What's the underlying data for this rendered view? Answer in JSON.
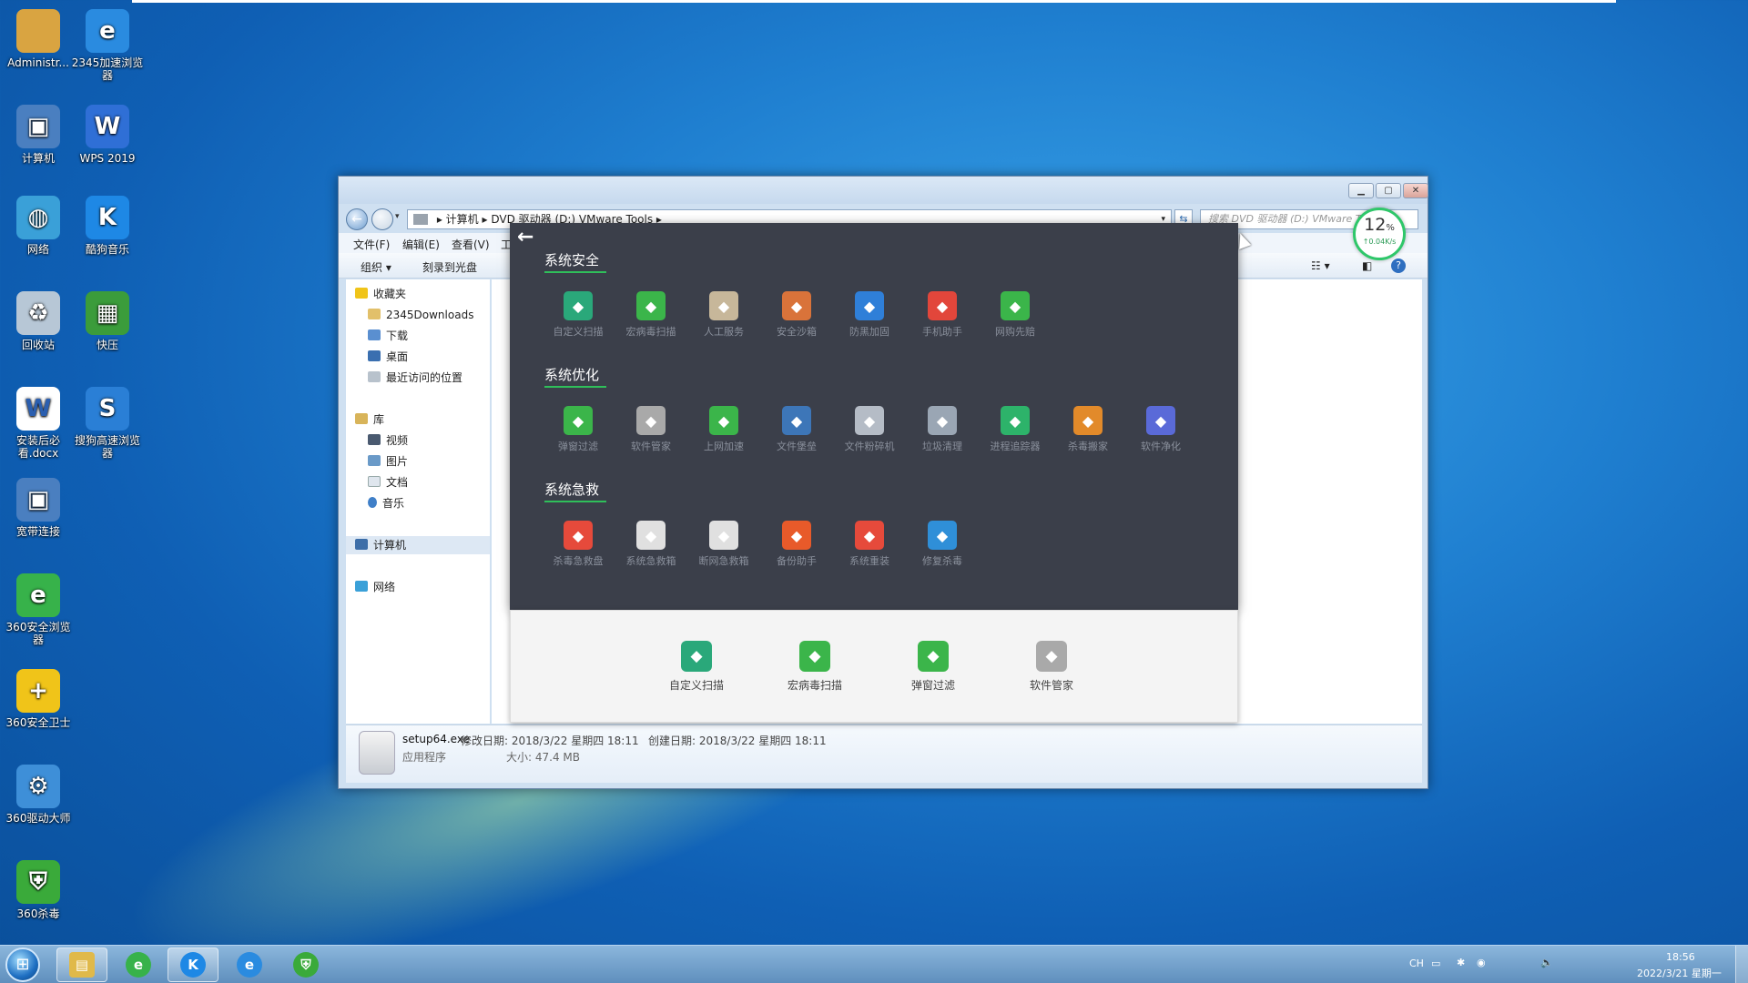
{
  "desktop": {
    "icons": [
      {
        "label": "Administr...",
        "icon": "user-folder-icon",
        "color": "#d9a441"
      },
      {
        "label": "2345加速浏览器",
        "icon": "browser-e-icon",
        "color": "#2a8be0"
      },
      {
        "label": "计算机",
        "icon": "computer-icon",
        "color": "#4a7fc0"
      },
      {
        "label": "WPS 2019",
        "icon": "wps-icon",
        "color": "#2f6fd6"
      },
      {
        "label": "网络",
        "icon": "network-globe-icon",
        "color": "#3aa0d8"
      },
      {
        "label": "酷狗音乐",
        "icon": "kugou-icon",
        "color": "#1e88e5"
      },
      {
        "label": "回收站",
        "icon": "recycle-bin-icon",
        "color": "#b7c7d6"
      },
      {
        "label": "快压",
        "icon": "kuaiya-icon",
        "color": "#3b9c3b"
      },
      {
        "label": "安装后必看.docx",
        "icon": "word-doc-icon",
        "color": "#ffffff"
      },
      {
        "label": "搜狗高速浏览器",
        "icon": "sogou-browser-icon",
        "color": "#2a7fd6"
      },
      {
        "label": "宽带连接",
        "icon": "broadband-icon",
        "color": "#4a7fc0"
      },
      {
        "label": "360安全浏览器",
        "icon": "360-browser-icon",
        "color": "#37b24a"
      },
      {
        "label": "360安全卫士",
        "icon": "360-guard-icon",
        "color": "#f0c419"
      },
      {
        "label": "360驱动大师",
        "icon": "360-driver-icon",
        "color": "#3e8fd8"
      },
      {
        "label": "360杀毒",
        "icon": "360-antivirus-icon",
        "color": "#3aaa3a"
      }
    ]
  },
  "window": {
    "address": [
      "计算机",
      "DVD 驱动器 (D:) VMware Tools"
    ],
    "search_placeholder": "搜索 DVD 驱动器 (D:) VMware Tools",
    "menu": [
      "文件(F)",
      "编辑(E)",
      "查看(V)",
      "工"
    ],
    "commands": [
      "组织 ▾",
      "刻录到光盘"
    ],
    "nav": {
      "favorites": "收藏夹",
      "favorites_items": [
        "2345Downloads",
        "下载",
        "桌面",
        "最近访问的位置"
      ],
      "library": "库",
      "library_items": [
        "视频",
        "图片",
        "文档",
        "音乐"
      ],
      "computer": "计算机",
      "network": "网络"
    },
    "status": {
      "filename": "setup64.exe",
      "modified": "修改日期: 2018/3/22 星期四 18:11",
      "created": "创建日期: 2018/3/22 星期四 18:11",
      "type": "应用程序",
      "size": "大小: 47.4 MB"
    }
  },
  "panel": {
    "back_icon": "←",
    "sections": [
      {
        "title": "系统安全",
        "tools": [
          {
            "label": "自定义扫描",
            "icon": "custom-scan-icon",
            "color": "#2aa87a"
          },
          {
            "label": "宏病毒扫描",
            "icon": "macro-scan-icon",
            "color": "#3bb54a"
          },
          {
            "label": "人工服务",
            "icon": "manual-service-icon",
            "color": "#c7b79a"
          },
          {
            "label": "安全沙箱",
            "icon": "sandbox-icon",
            "color": "#d9733a"
          },
          {
            "label": "防黑加固",
            "icon": "anti-hack-icon",
            "color": "#2f7fd8"
          },
          {
            "label": "手机助手",
            "icon": "phone-assistant-icon",
            "color": "#e2463b"
          },
          {
            "label": "网购先赔",
            "icon": "shopping-shield-icon",
            "color": "#3bb54a"
          }
        ]
      },
      {
        "title": "系统优化",
        "tools": [
          {
            "label": "弹窗过滤",
            "icon": "popup-filter-icon",
            "color": "#3bb54a"
          },
          {
            "label": "软件管家",
            "icon": "software-manager-icon",
            "color": "#a9a9a9"
          },
          {
            "label": "上网加速",
            "icon": "net-accelerate-icon",
            "color": "#3bb54a"
          },
          {
            "label": "文件堡垒",
            "icon": "file-fortress-icon",
            "color": "#3d76b8"
          },
          {
            "label": "文件粉碎机",
            "icon": "file-shredder-icon",
            "color": "#b5bcc6"
          },
          {
            "label": "垃圾清理",
            "icon": "junk-clean-icon",
            "color": "#9aa6b4"
          },
          {
            "label": "进程追踪器",
            "icon": "process-tracker-icon",
            "color": "#2db36a"
          },
          {
            "label": "杀毒搬家",
            "icon": "av-move-icon",
            "color": "#e28a2a"
          },
          {
            "label": "软件净化",
            "icon": "software-purify-icon",
            "color": "#5a6ad8"
          }
        ]
      },
      {
        "title": "系统急救",
        "tools": [
          {
            "label": "杀毒急救盘",
            "icon": "rescue-disk-icon",
            "color": "#e64a3b"
          },
          {
            "label": "系统急救箱",
            "icon": "system-rescue-box-icon",
            "color": "#e0e0e0"
          },
          {
            "label": "断网急救箱",
            "icon": "network-rescue-box-icon",
            "color": "#e0e0e0"
          },
          {
            "label": "备份助手",
            "icon": "backup-assistant-icon",
            "color": "#e85a2a"
          },
          {
            "label": "系统重装",
            "icon": "system-reinstall-icon",
            "color": "#e64a3b"
          },
          {
            "label": "修复杀毒",
            "icon": "repair-av-icon",
            "color": "#2f8fd8"
          }
        ]
      }
    ],
    "pinned": [
      {
        "label": "自定义扫描",
        "icon": "custom-scan-icon",
        "color": "#2aa87a"
      },
      {
        "label": "宏病毒扫描",
        "icon": "macro-scan-icon",
        "color": "#3bb54a"
      },
      {
        "label": "弹窗过滤",
        "icon": "popup-filter-icon",
        "color": "#3bb54a"
      },
      {
        "label": "软件管家",
        "icon": "software-manager-icon",
        "color": "#a9a9a9"
      }
    ]
  },
  "speed_widget": {
    "percent": "12",
    "unit": "%",
    "rate": "↑0.04K/s"
  },
  "taskbar": {
    "items": [
      {
        "name": "explorer",
        "icon": "file-explorer-icon",
        "color": "#e0b94a",
        "active": true
      },
      {
        "name": "360browser",
        "icon": "360-browser-icon",
        "color": "#37b24a",
        "active": false
      },
      {
        "name": "kugou",
        "icon": "kugou-icon",
        "color": "#1e88e5",
        "active": true
      },
      {
        "name": "ie",
        "icon": "browser-e-icon",
        "color": "#2a8be0",
        "active": false
      },
      {
        "name": "360guard",
        "icon": "360-antivirus-icon",
        "color": "#3aaa3a",
        "active": false
      }
    ],
    "tray": {
      "lang": "CH",
      "time": "18:56",
      "date": "2022/3/21 星期一"
    }
  }
}
